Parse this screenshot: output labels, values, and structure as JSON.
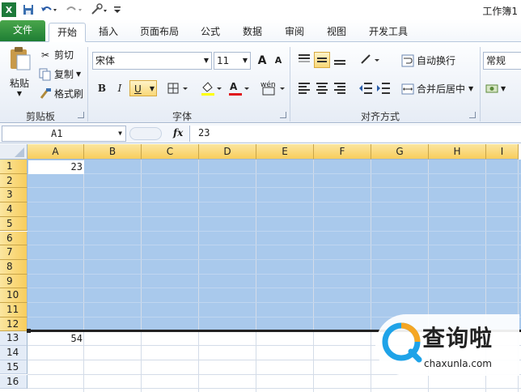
{
  "window": {
    "title": "工作簿1"
  },
  "tabs": [
    {
      "label": "文件"
    },
    {
      "label": "开始"
    },
    {
      "label": "插入"
    },
    {
      "label": "页面布局"
    },
    {
      "label": "公式"
    },
    {
      "label": "数据"
    },
    {
      "label": "审阅"
    },
    {
      "label": "视图"
    },
    {
      "label": "开发工具"
    }
  ],
  "clipboard": {
    "paste_label": "粘贴",
    "cut_label": "剪切",
    "copy_label": "复制",
    "format_painter_label": "格式刷",
    "group_label": "剪贴板"
  },
  "font": {
    "name": "宋体",
    "size": "11",
    "bold": "B",
    "italic": "I",
    "underline": "U",
    "group_label": "字体",
    "grow_label": "A",
    "shrink_label": "A",
    "font_color_label": "A",
    "phonetic_label": "wén"
  },
  "alignment": {
    "wrap_label": "自动换行",
    "merge_label": "合并后居中",
    "group_label": "对齐方式"
  },
  "number": {
    "format": "常规"
  },
  "formula_bar": {
    "name_box": "A1",
    "fx": "fx",
    "value": "23"
  },
  "columns": [
    "A",
    "B",
    "C",
    "D",
    "E",
    "F",
    "G",
    "H",
    "I"
  ],
  "rows": [
    "1",
    "2",
    "3",
    "4",
    "5",
    "6",
    "7",
    "8",
    "9",
    "10",
    "11",
    "12",
    "13",
    "14",
    "15",
    "16"
  ],
  "cells": {
    "A1": "23",
    "A13": "54"
  },
  "watermark": {
    "cn": "查询啦",
    "url": "chaxunla.com"
  },
  "colors": {
    "accent_green": "#1e7e34",
    "selection": "#a9c9ec",
    "header_highlight": "#f8cd5c"
  }
}
